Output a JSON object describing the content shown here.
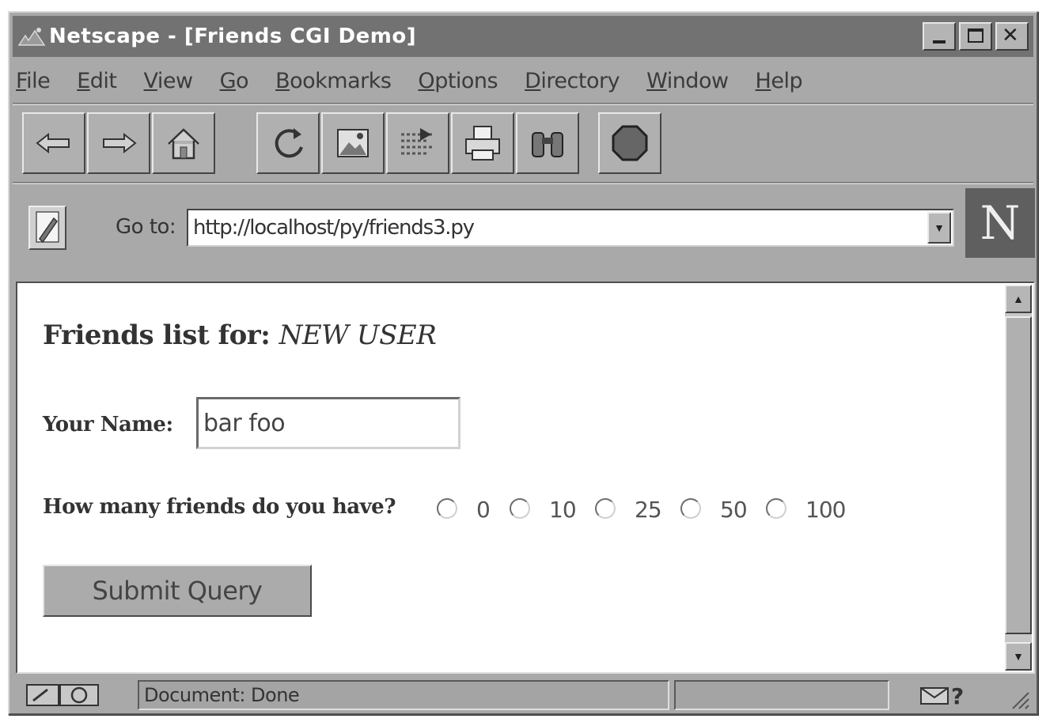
{
  "window": {
    "title": "Netscape - [Friends CGI Demo]"
  },
  "menubar": [
    {
      "pre": "",
      "u": "F",
      "post": "ile"
    },
    {
      "pre": "",
      "u": "E",
      "post": "dit"
    },
    {
      "pre": "",
      "u": "V",
      "post": "iew"
    },
    {
      "pre": "",
      "u": "G",
      "post": "o"
    },
    {
      "pre": "",
      "u": "B",
      "post": "ookmarks"
    },
    {
      "pre": "",
      "u": "O",
      "post": "ptions"
    },
    {
      "pre": "",
      "u": "D",
      "post": "irectory"
    },
    {
      "pre": "",
      "u": "W",
      "post": "indow"
    },
    {
      "pre": "",
      "u": "H",
      "post": "elp"
    }
  ],
  "toolbar": {
    "buttons": [
      "back-icon",
      "forward-icon",
      "home-icon",
      "reload-icon",
      "images-icon",
      "open-icon",
      "print-icon",
      "find-icon",
      "stop-icon"
    ]
  },
  "location": {
    "label": "Go to:",
    "url": "http://localhost/py/friends3.py"
  },
  "page": {
    "heading_prefix": "Friends list for:",
    "heading_user": "NEW USER",
    "name_label": "Your Name:",
    "name_value": "bar foo",
    "friends_question": "How many friends do you have?",
    "friend_options": [
      "0",
      "10",
      "25",
      "50",
      "100"
    ],
    "submit_label": "Submit Query"
  },
  "status": {
    "text": "Document: Done"
  },
  "colors": {
    "chrome": "#a9a9a9",
    "titlebar": "#727272",
    "content_bg": "#ffffff"
  }
}
